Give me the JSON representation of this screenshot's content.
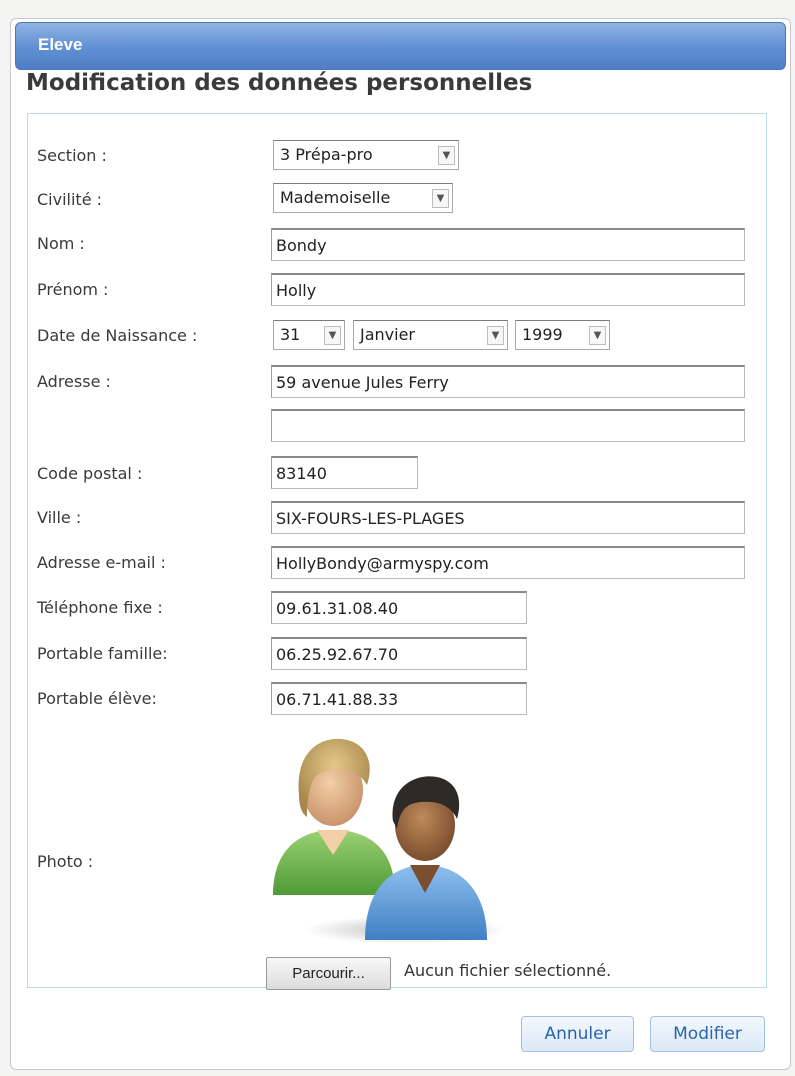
{
  "window": {
    "title": "Eleve"
  },
  "form": {
    "heading": "Modification des données personnelles",
    "section": {
      "label": "Section :",
      "value": "3 Prépa-pro"
    },
    "civilite": {
      "label": "Civilité :",
      "value": "Mademoiselle"
    },
    "nom": {
      "label": "Nom :",
      "value": "Bondy"
    },
    "prenom": {
      "label": "Prénom :",
      "value": "Holly"
    },
    "naissance": {
      "label": "Date de Naissance :",
      "day": "31",
      "month": "Janvier",
      "year": "1999"
    },
    "adresse": {
      "label": "Adresse :",
      "line1": "59 avenue Jules Ferry",
      "line2": ""
    },
    "code_postal": {
      "label": "Code postal :",
      "value": "83140"
    },
    "ville": {
      "label": "Ville :",
      "value": "SIX-FOURS-LES-PLAGES"
    },
    "email": {
      "label": "Adresse e-mail :",
      "value": "HollyBondy@armyspy.com"
    },
    "tel_fixe": {
      "label": "Téléphone fixe :",
      "value": "09.61.31.08.40"
    },
    "portable_famille": {
      "label": "Portable famille:",
      "value": "06.25.92.67.70"
    },
    "portable_eleve": {
      "label": "Portable élève:",
      "value": "06.71.41.88.33"
    },
    "photo": {
      "label": "Photo :",
      "icon": "users-icon",
      "browse_label": "Parcourir...",
      "no_file_text": "Aucun fichier sélectionné."
    }
  },
  "actions": {
    "cancel_label": "Annuler",
    "submit_label": "Modifier"
  }
}
